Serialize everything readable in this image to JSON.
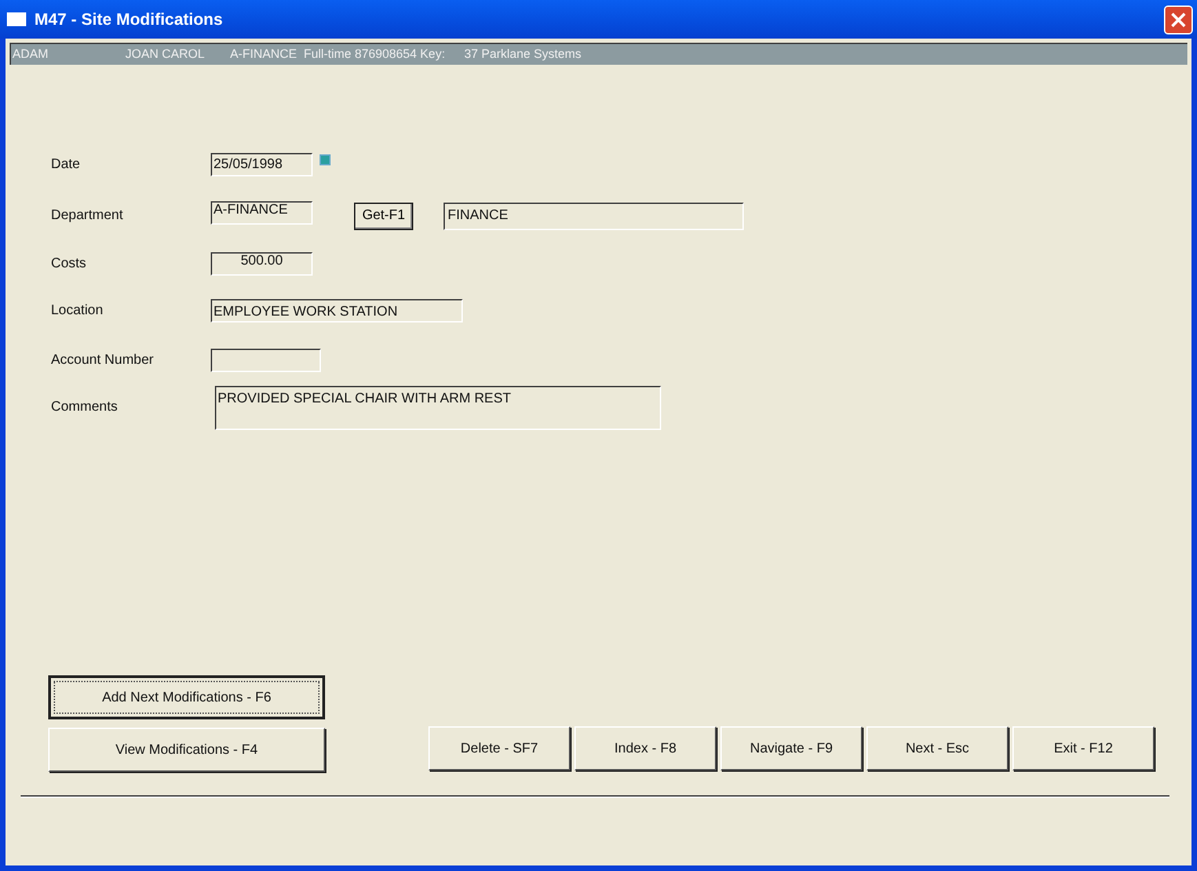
{
  "window": {
    "title": "M47 - Site Modifications"
  },
  "info_bar": [
    "ADAM",
    "JOAN CAROL",
    "A-FINANCE  Full-time 876908654 Key:",
    "37 Parklane Systems"
  ],
  "form": {
    "date": {
      "label": "Date",
      "value": "25/05/1998"
    },
    "department": {
      "label": "Department",
      "value": "A-FINANCE",
      "button": "Get-F1",
      "name": "FINANCE"
    },
    "costs": {
      "label": "Costs",
      "value": "500.00"
    },
    "location": {
      "label": "Location",
      "value": "EMPLOYEE WORK STATION"
    },
    "account_number": {
      "label": "Account Number"
    },
    "comments": {
      "label": "Comments",
      "value": "PROVIDED SPECIAL CHAIR WITH ARM REST"
    }
  },
  "buttons": [
    {
      "label": "Add Next Modifications - F6",
      "focused": true
    },
    {
      "label": "View Modifications - F4",
      "focused": false
    },
    {
      "label": "Delete - SF7",
      "focused": false
    },
    {
      "label": "Index - F8",
      "focused": false
    },
    {
      "label": "Navigate - F9",
      "focused": false
    },
    {
      "label": "Next - Esc",
      "focused": false
    },
    {
      "label": "Exit - F12",
      "focused": false
    }
  ]
}
